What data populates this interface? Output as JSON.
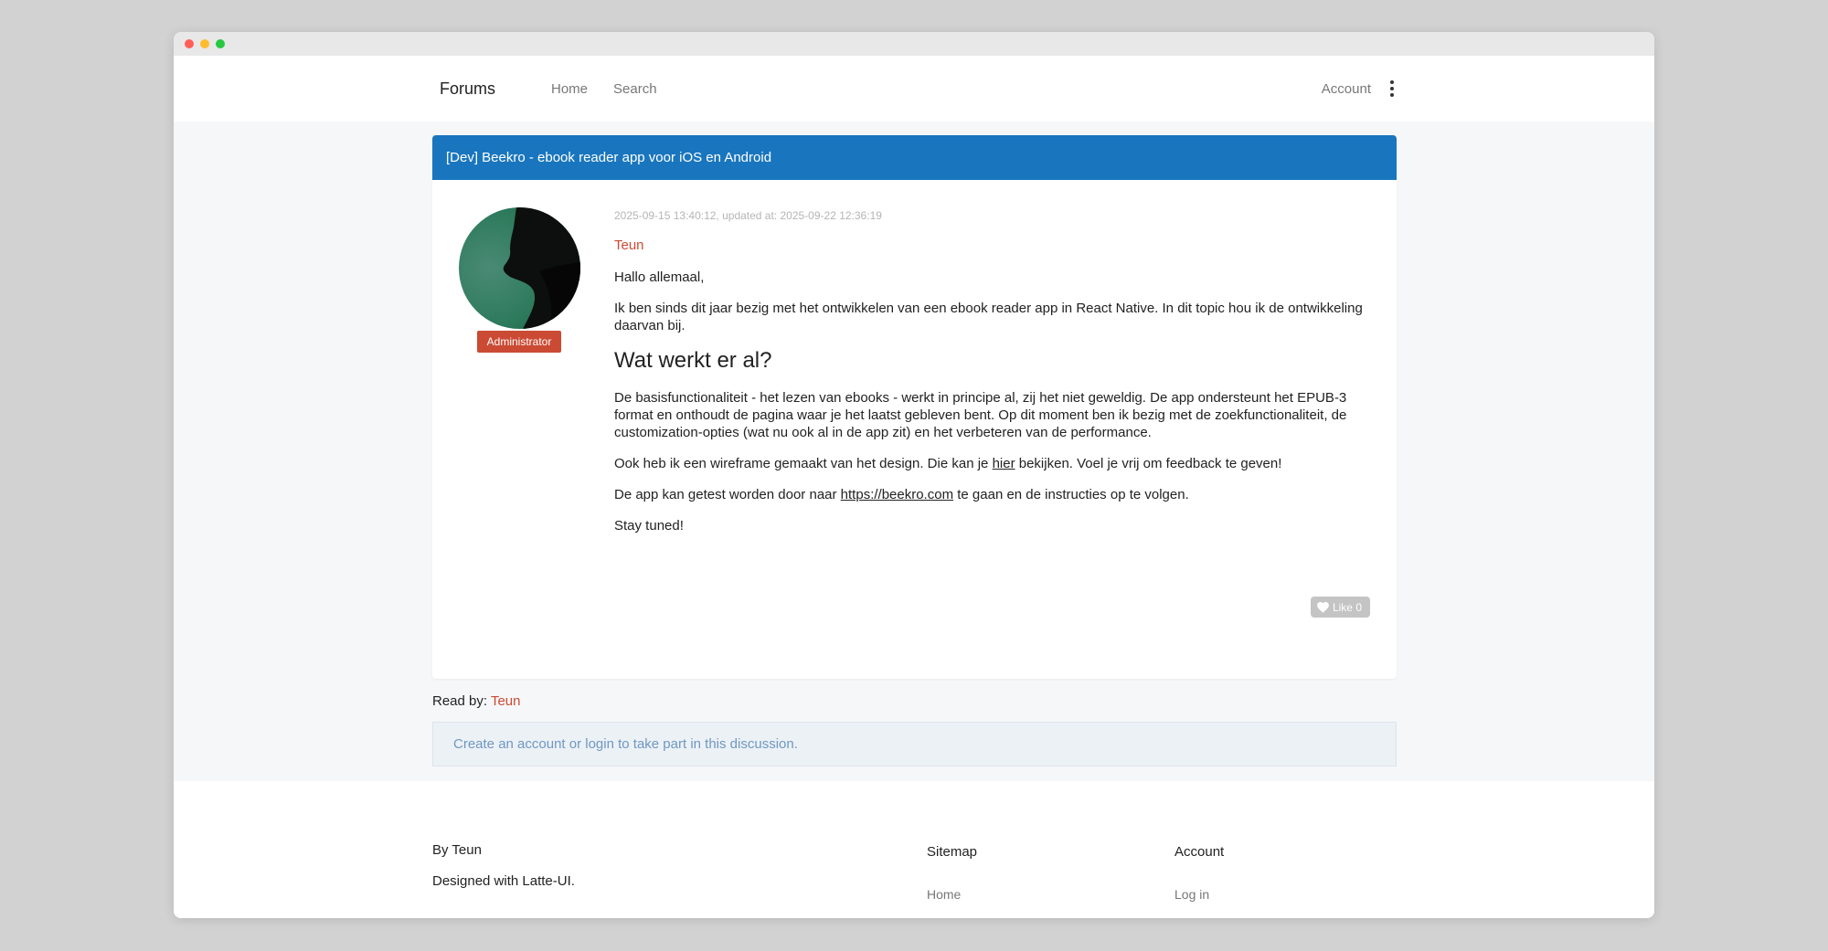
{
  "window": {
    "controls": [
      "close",
      "minimize",
      "maximize"
    ]
  },
  "nav": {
    "brand": "Forums",
    "links": [
      "Home",
      "Search"
    ],
    "account": "Account",
    "more_icon": "kebab-menu-icon"
  },
  "topic": {
    "title": "[Dev] Beekro - ebook reader app voor iOS en Android"
  },
  "post": {
    "meta": "2025-09-15 13:40:12, updated at: 2025-09-22 12:36:19",
    "author": "Teun",
    "role": "Administrator",
    "greeting": "Hallo allemaal,",
    "intro": "Ik ben sinds dit jaar bezig met het ontwikkelen van een ebook reader app in React Native. In dit topic hou ik de ontwikkeling daarvan bij.",
    "heading": "Wat werkt er al?",
    "features": "De basisfunctionaliteit - het lezen van ebooks - werkt in principe al, zij het niet geweldig. De app ondersteunt het EPUB-3 format en onthoudt de pagina waar je het laatst gebleven bent. Op dit moment ben ik bezig met de zoekfunctionaliteit, de customization-opties (wat nu ook al in de app zit) en het verbeteren van de performance.",
    "wireframe_before": "Ook heb ik een wireframe gemaakt van het design. Die kan je ",
    "wireframe_link": "hier",
    "wireframe_after": " bekijken. Voel je vrij om feedback te geven!",
    "test_before": "De app kan getest worden door naar ",
    "test_link": "https://beekro.com",
    "test_after": " te gaan en de instructies op te volgen.",
    "closing": "Stay tuned!",
    "like_label": "Like 0",
    "like_icon": "heart-icon"
  },
  "read_by": {
    "label": "Read by: ",
    "users": "Teun"
  },
  "notice": "Create an account or login to take part in this discussion.",
  "footer": {
    "by": "By Teun",
    "designed": "Designed with Latte-UI.",
    "sitemap_title": "Sitemap",
    "sitemap_links": [
      "Home"
    ],
    "account_title": "Account",
    "account_links": [
      "Log in"
    ]
  },
  "colors": {
    "header_blue": "#1976be",
    "accent_red": "#cc4a32",
    "badge_red": "#cb4a34",
    "notice_text": "#6f98c4"
  }
}
